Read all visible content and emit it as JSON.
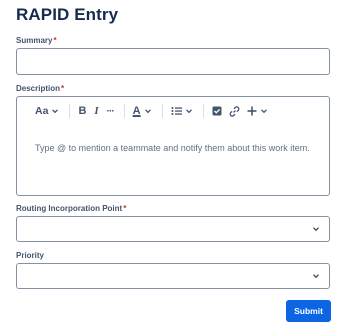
{
  "form": {
    "title": "RAPID Entry",
    "summary": {
      "label": "Summary",
      "required_mark": "*",
      "value": ""
    },
    "description": {
      "label": "Description",
      "required_mark": "*",
      "placeholder": "Type @ to mention a teammate and notify them about this work item.",
      "toolbar": {
        "text_style": "Aa",
        "bold": "B",
        "italic": "I",
        "more": "···",
        "text_color": "A"
      }
    },
    "routing": {
      "label": "Routing Incorporation Point",
      "required_mark": "*",
      "value": ""
    },
    "priority": {
      "label": "Priority",
      "value": ""
    },
    "submit_label": "Submit"
  },
  "colors": {
    "accent": "#0c66e4",
    "required": "#c9372c",
    "text": "#172b4d",
    "border": "#8590a2"
  },
  "icons": [
    "chevron-down-icon",
    "checkbox-icon",
    "link-icon",
    "plus-icon",
    "bullet-list-icon"
  ]
}
